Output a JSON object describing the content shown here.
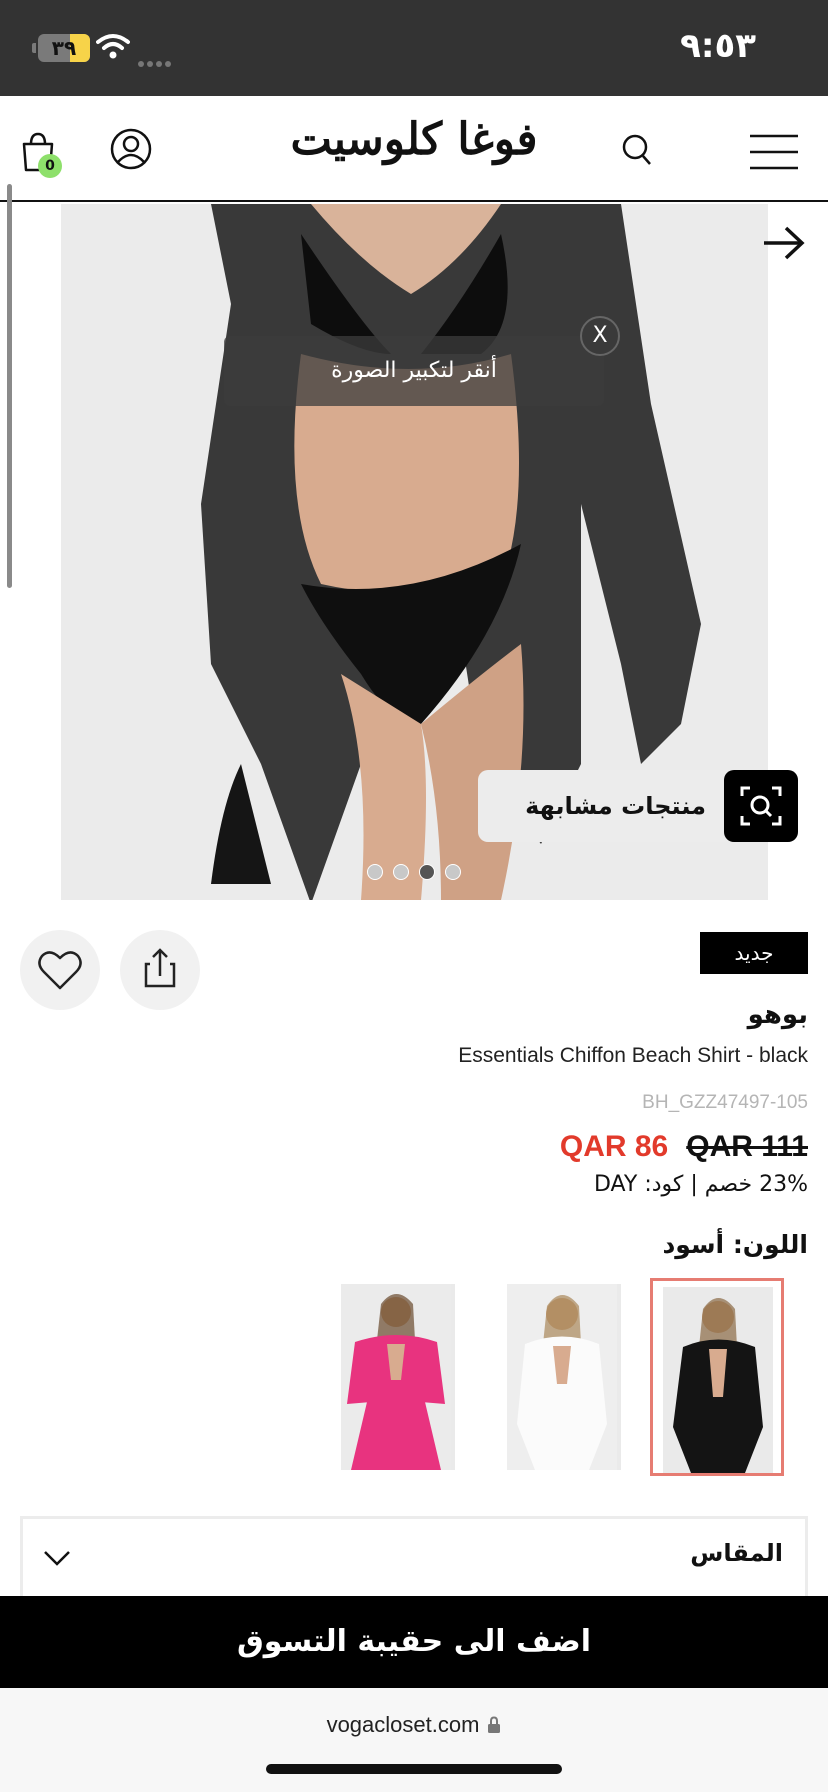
{
  "status_bar": {
    "time": "٩:٥٣",
    "battery": "٣٩",
    "battery_level": 0.39
  },
  "header": {
    "logo": "فوغا كلوسيت",
    "cart_count": "0"
  },
  "hero": {
    "zoom_hint": "أنقر لتكبير الصورة",
    "close": "X",
    "similar_products": "منتجات مشابهة",
    "dots": [
      {
        "active": false
      },
      {
        "active": false
      },
      {
        "active": true
      },
      {
        "active": false
      }
    ]
  },
  "product": {
    "badge": "جديد",
    "brand": "بوهو",
    "name": "Essentials Chiffon Beach Shirt - black",
    "sku": "BH_GZZ47497-105",
    "price_new": "QAR 86",
    "price_old": "QAR 111",
    "promo": "23% خصم | كود: DAY",
    "color_label": "اللون: أسود",
    "swatches": [
      {
        "color": "#111111",
        "selected": true
      },
      {
        "color": "#f4f4f4",
        "selected": false
      },
      {
        "color": "#e8337f",
        "selected": false
      }
    ],
    "size_label": "المقاس"
  },
  "add_to_bag": "اضف الى حقيبة التسوق",
  "url": "vogacloset.com",
  "colors": {
    "sale_red": "#e23a2b",
    "swatch_border": "#e67c72",
    "badge_green": "#8ee06b"
  }
}
